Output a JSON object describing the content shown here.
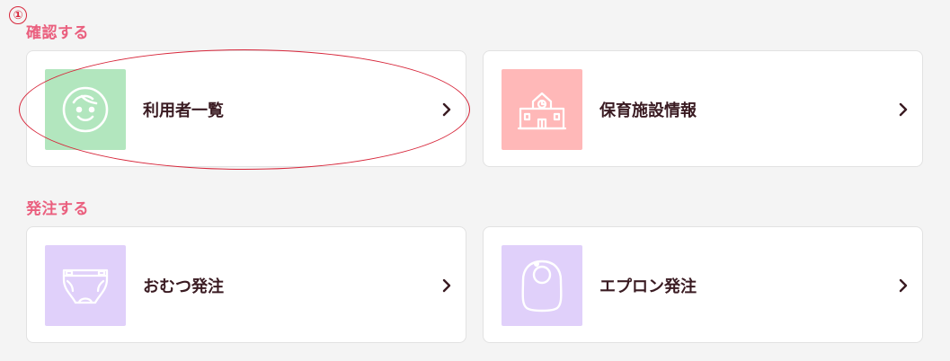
{
  "annotation": {
    "marker": "①"
  },
  "sections": [
    {
      "title": "確認する"
    },
    {
      "title": "発注する"
    }
  ],
  "cards": [
    {
      "label": "利用者一覧",
      "icon": "smiley-face-icon",
      "tile_color": "#b2e6be"
    },
    {
      "label": "保育施設情報",
      "icon": "school-building-icon",
      "tile_color": "#ffb8b8"
    },
    {
      "label": "おむつ発注",
      "icon": "diaper-icon",
      "tile_color": "#e0d0fa"
    },
    {
      "label": "エプロン発注",
      "icon": "bib-icon",
      "tile_color": "#e0d0fa"
    }
  ],
  "colors": {
    "accent": "#ea5f7e",
    "annotation": "#d7273b",
    "text": "#3a1b22"
  }
}
